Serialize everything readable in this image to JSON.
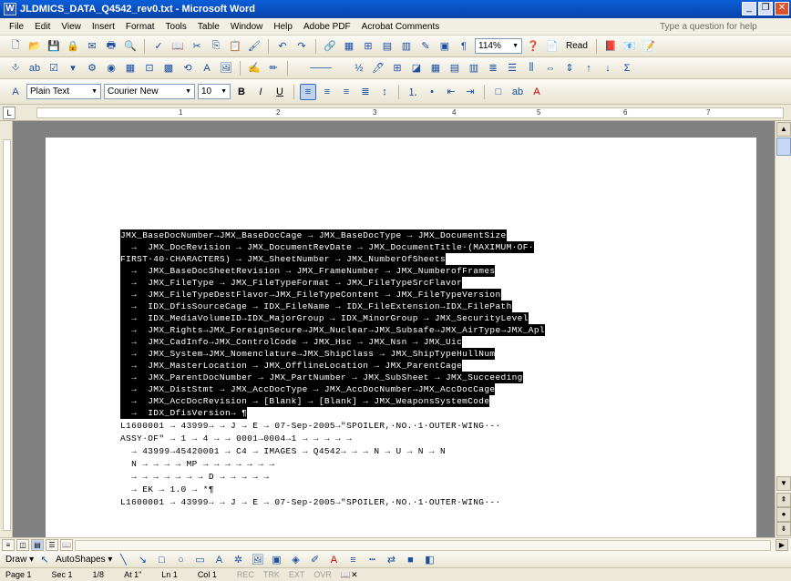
{
  "window": {
    "title": "JLDMICS_DATA_Q4542_rev0.txt - Microsoft Word",
    "minimize": "_",
    "maximize": "❐",
    "close": "✕"
  },
  "menubar": {
    "items": [
      "File",
      "Edit",
      "View",
      "Insert",
      "Format",
      "Tools",
      "Table",
      "Window",
      "Help",
      "Adobe PDF",
      "Acrobat Comments"
    ],
    "help_placeholder": "Type a question for help"
  },
  "toolbar_standard": {
    "zoom": "114%",
    "read_label": "Read"
  },
  "toolbar_formatting": {
    "style": "Plain Text",
    "font": "Courier New",
    "size": "10",
    "bold": "B",
    "italic": "I",
    "underline": "U"
  },
  "ruler": {
    "numbers": [
      "1",
      "2",
      "3",
      "4",
      "5",
      "6",
      "7"
    ]
  },
  "document": {
    "selected_lines": [
      "JMX_BaseDocNumber→JMX_BaseDocCage → JMX_BaseDocType → JMX_DocumentSize",
      "  →  JMX_DocRevision → JMX_DocumentRevDate → JMX_DocumentTitle·(MAXIMUM·OF·",
      "FIRST·40·CHARACTERS) → JMX_SheetNumber → JMX_NumberOfSheets",
      "  →  JMX_BaseDocSheetRevision → JMX_FrameNumber → JMX_NumberofFrames",
      "  →  JMX_FileType → JMX_FileTypeFormat → JMX_FileTypeSrcFlavor",
      "  →  JMX_FileTypeDestFlavor→JMX_FileTypeContent → JMX_FileTypeVersion",
      "  →  IDX_DfisSourceCage → IDX_FileName → IDX_FileExtension→IDX_FilePath",
      "  →  IDX_MediaVolumeID→IDX_MajorGroup → IDX_MinorGroup → JMX_SecurityLevel",
      "  →  JMX_Rights→JMX_ForeignSecure→JMX_Nuclear→JMX_Subsafe→JMX_AirType→JMX_Apl",
      "  →  JMX_CadInfo→JMX_ControlCode → JMX_Hsc → JMX_Nsn → JMX_Uic",
      "  →  JMX_System→JMX_Nomenclature→JMX_ShipClass → JMX_ShipTypeHullNum",
      "  →  JMX_MasterLocation → JMX_OfflineLocation → JMX_ParentCage",
      "  →  JMX_ParentDocNumber → JMX_PartNumber → JMX_SubSheet → JMX_Succeeding",
      "  →  JMX_DistStmt → JMX_AccDocType → JMX_AccDocNumber→JMX_AccDocCage",
      "  →  JMX_AccDocRevision → [Blank] → [Blank] → JMX_WeaponsSystemCode",
      "  →  IDX_DfisVersion→ ¶"
    ],
    "plain_lines": [
      "L1600001 → 43999→ → J → E → 07-Sep-2005→\"SPOILER,·NO.·1·OUTER·WING·-·",
      "ASSY·OF\" → 1 → 4 → → 0001→0004→1 → → → → →",
      "  → 43999→45420001 → C4 → IMAGES → Q4542→ → → N → U → N → N",
      "  N → → → → MP → → → → → → →",
      "  → → → → → → → D → → → → →",
      "  → EK → 1.0 → *¶",
      "L1600001 → 43999→ → J → E → 07-Sep-2005→\"SPOILER,·NO.·1·OUTER·WING·-·"
    ]
  },
  "drawbar": {
    "draw_label": "Draw ▾",
    "autoshapes_label": "AutoShapes ▾"
  },
  "statusbar": {
    "page": "Page 1",
    "section": "Sec 1",
    "page_of": "1/8",
    "at": "At 1\"",
    "line": "Ln 1",
    "col": "Col 1",
    "rec": "REC",
    "trk": "TRK",
    "ext": "EXT",
    "ovr": "OVR"
  }
}
